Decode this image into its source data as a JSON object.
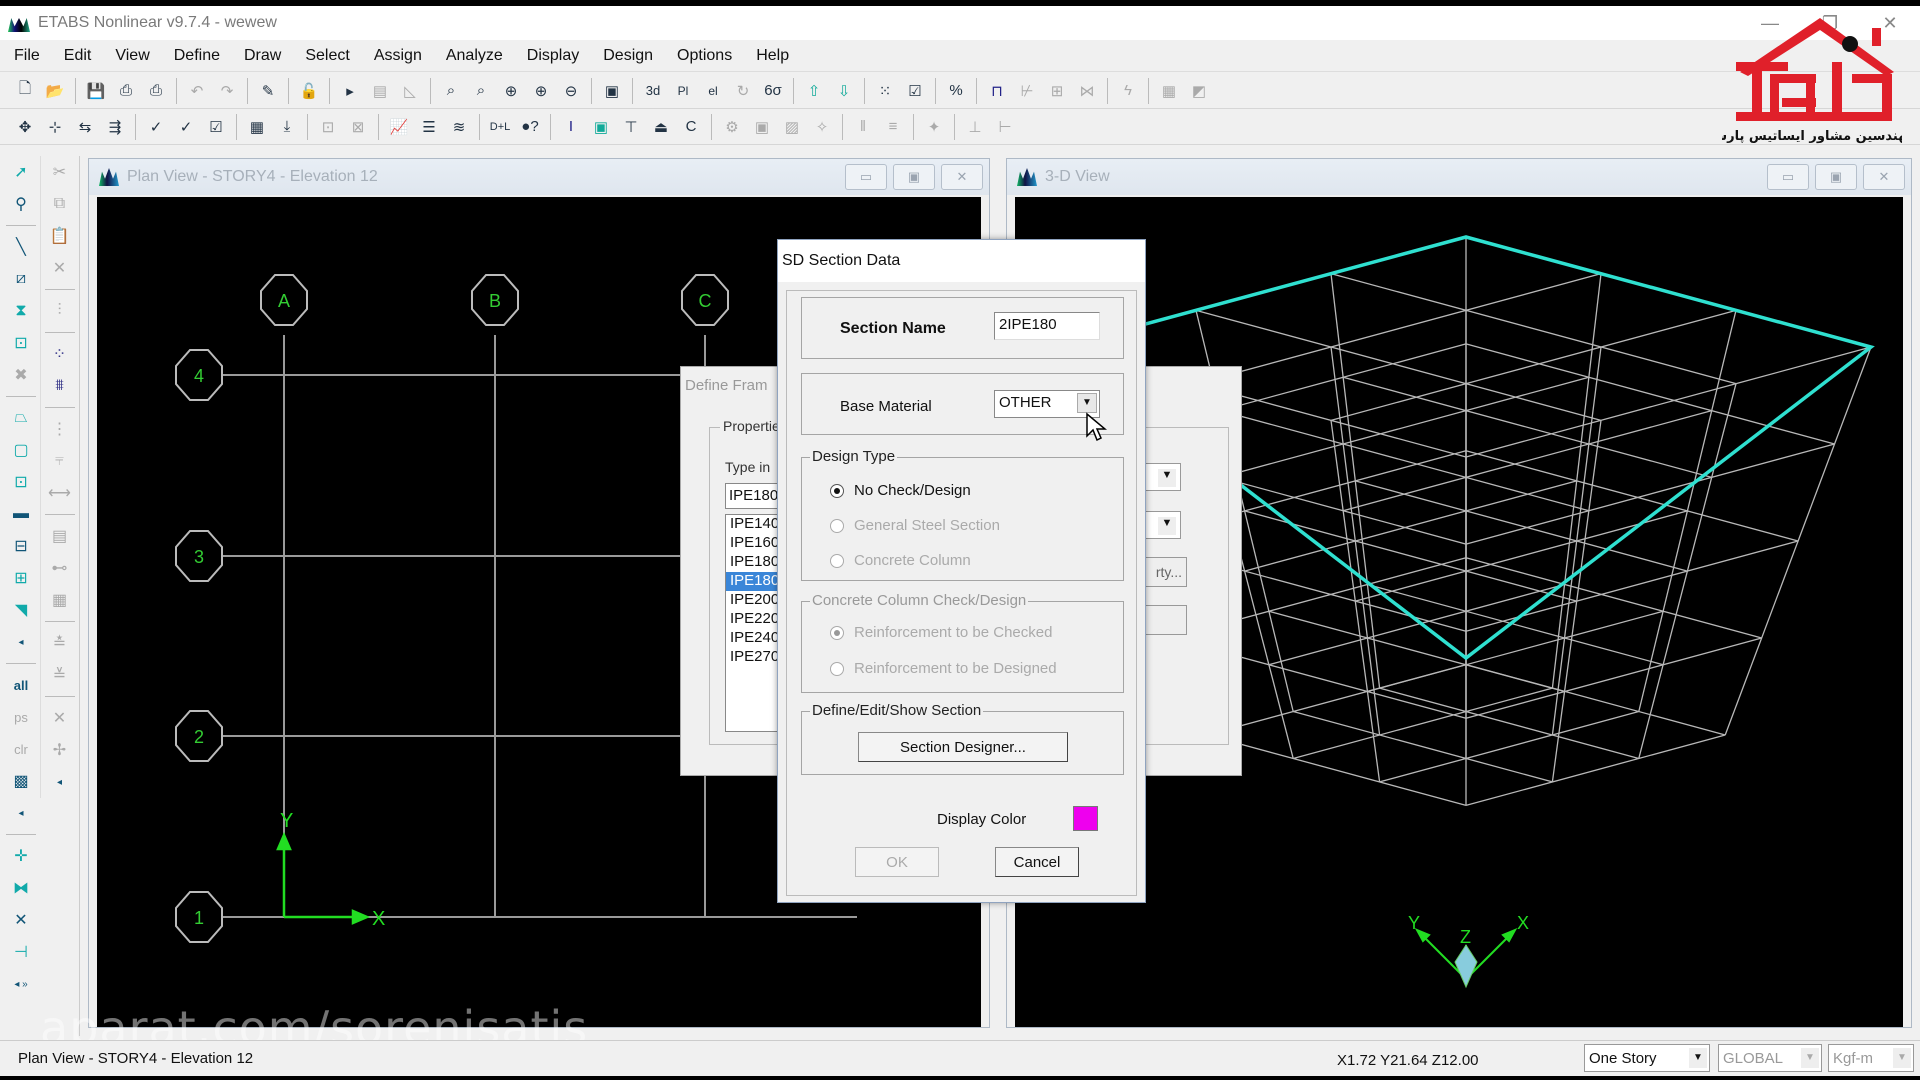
{
  "app": {
    "title": "ETABS Nonlinear v9.7.4 - wewew",
    "window_controls": [
      "minimize",
      "restore",
      "close"
    ]
  },
  "menu": [
    "File",
    "Edit",
    "View",
    "Define",
    "Draw",
    "Select",
    "Assign",
    "Analyze",
    "Display",
    "Design",
    "Options",
    "Help"
  ],
  "toolbar1": [
    "new-icon",
    "open-icon",
    "save-icon",
    "print-icon",
    "print-table-icon",
    "undo-icon",
    "redo-icon",
    "pencil-icon",
    "lock-icon",
    "run-icon",
    "run-step-icon",
    "run-nonlinear-icon",
    "zoom-window-icon",
    "zoom-restore-icon",
    "zoom-in-icon",
    "zoom-out-icon",
    "zoom-shrink-icon",
    "pan-icon",
    "3d-view-icon",
    "plan-view-icon",
    "elevation-view-icon",
    "rotate-icon",
    "perspective-icon",
    "up-icon",
    "down-icon",
    "object-shrink-icon",
    "set-display-icon",
    "percent-icon",
    "frame-icon",
    "brace-icon",
    "wall-icon",
    "deformed-icon",
    "energy-icon",
    "design-icon",
    "design2-icon"
  ],
  "toolbar2": [
    "move-icon",
    "replicate-icon",
    "mirror-icon",
    "align-icon",
    "checkmark-icon",
    "line-check-icon",
    "box-check-icon",
    "grid-icon",
    "snap-icon",
    "add-icon",
    "delete-icon",
    "chart-icon",
    "bar-icon",
    "layer-icon",
    "dl-e-icon",
    "query-icon",
    "i-section-icon",
    "slab-icon",
    "column-icon",
    "footing-icon",
    "channel-icon",
    "steel-design-icon",
    "concrete-design-icon",
    "composite-icon",
    "joist-icon",
    "wall-design-icon",
    "list-icon",
    "pm-icon",
    "table-icon",
    "export-icon"
  ],
  "logo": {
    "caption": "مهندسین مشاور ایساتیس پارس",
    "color": "#e0202a"
  },
  "plan_view": {
    "title": "Plan View - STORY4 - Elevation 12",
    "grid_x": [
      "A",
      "B",
      "C"
    ],
    "grid_y": [
      "4",
      "3",
      "2",
      "1"
    ],
    "axis_x": "X",
    "axis_y": "Y"
  },
  "view_3d": {
    "title": "3-D View",
    "axis_x": "X",
    "axis_y": "Y",
    "axis_z": "Z",
    "highlight_color": "#2fe0d0"
  },
  "define_frame_dialog": {
    "title": "Define Frame Properties",
    "title_visible": "Define Fram",
    "group_label": "Properties",
    "type_in_label": "Type in",
    "type_in_value": "IPE180",
    "list": [
      "IPE140",
      "IPE160",
      "IPE180",
      "IPE180",
      "IPE200",
      "IPE220",
      "IPE240",
      "IPE270"
    ],
    "selected_index": 3,
    "button_partial": "rty..."
  },
  "sd_dialog": {
    "title": "SD Section Data",
    "section_name_label": "Section Name",
    "section_name_value": "2IPE180",
    "base_material_label": "Base Material",
    "base_material_value": "OTHER",
    "design_type_label": "Design Type",
    "design_type_options": [
      {
        "label": "No Check/Design",
        "selected": true,
        "enabled": true
      },
      {
        "label": "General Steel Section",
        "selected": false,
        "enabled": false
      },
      {
        "label": "Concrete Column",
        "selected": false,
        "enabled": false
      }
    ],
    "concrete_group_label": "Concrete Column Check/Design",
    "concrete_options": [
      {
        "label": "Reinforcement to be Checked",
        "selected": true,
        "enabled": false
      },
      {
        "label": "Reinforcement to be Designed",
        "selected": false,
        "enabled": false
      }
    ],
    "define_group_label": "Define/Edit/Show Section",
    "section_designer_button": "Section Designer...",
    "display_color_label": "Display Color",
    "display_color": "#ee00ee",
    "ok_button": "OK",
    "cancel_button": "Cancel"
  },
  "status_bar": {
    "left_text": "Plan View - STORY4 - Elevation 12",
    "coordinates": "X1.72  Y21.64  Z12.00",
    "story_option": "One Story",
    "coord_system": "GLOBAL",
    "units": "Kgf-m"
  },
  "watermark": "aparat.com/sorenisatis"
}
